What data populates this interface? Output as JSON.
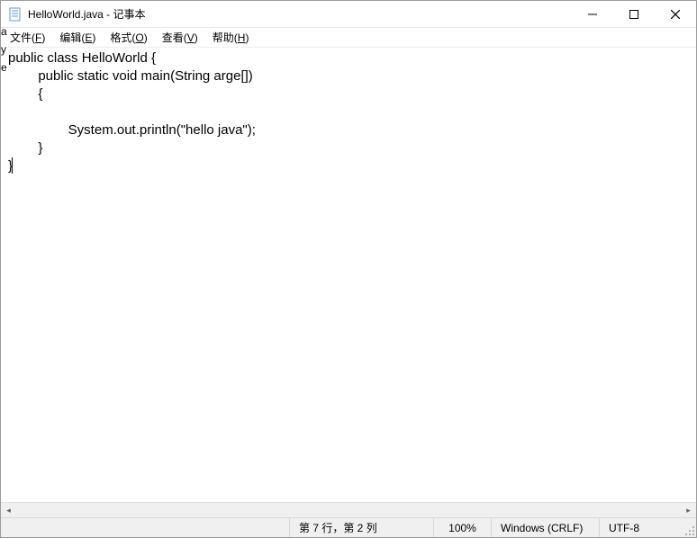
{
  "window": {
    "title": "HelloWorld.java - 记事本"
  },
  "menu": {
    "file": {
      "label": "文件",
      "hotkey": "F"
    },
    "edit": {
      "label": "编辑",
      "hotkey": "E"
    },
    "format": {
      "label": "格式",
      "hotkey": "O"
    },
    "view": {
      "label": "查看",
      "hotkey": "V"
    },
    "help": {
      "label": "帮助",
      "hotkey": "H"
    }
  },
  "left_edge": {
    "a": "a",
    "b": "y",
    "c": "e"
  },
  "editor": {
    "content": "public class HelloWorld {\n        public static void main(String arge[])\n        {\n\n                System.out.println(\"hello java\");\n        }\n}"
  },
  "status": {
    "position": "第 7 行，第 2 列",
    "zoom": "100%",
    "eol": "Windows (CRLF)",
    "encoding": "UTF-8"
  }
}
